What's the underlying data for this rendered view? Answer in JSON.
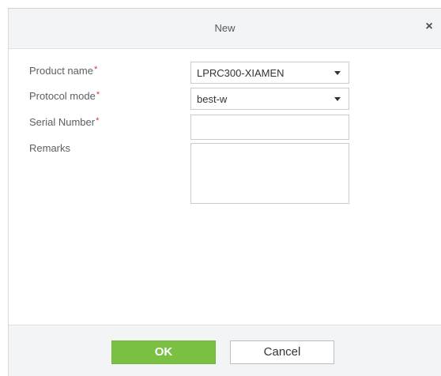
{
  "dialog": {
    "title": "New",
    "close_glyph": "×",
    "close_icon": "close-icon"
  },
  "form": {
    "product_name": {
      "label": "Product name",
      "required": "*",
      "value": "LPRC300-XIAMEN"
    },
    "protocol_mode": {
      "label": "Protocol mode",
      "required": "*",
      "value": "best-w"
    },
    "serial_number": {
      "label": "Serial Number",
      "required": "*",
      "value": ""
    },
    "remarks": {
      "label": "Remarks",
      "value": ""
    }
  },
  "buttons": {
    "ok_label": "OK",
    "cancel_label": "Cancel"
  },
  "colors": {
    "ok_button": "#7ac143",
    "required_mark": "#e0342c",
    "titlebar_bg": "#f3f4f5"
  }
}
